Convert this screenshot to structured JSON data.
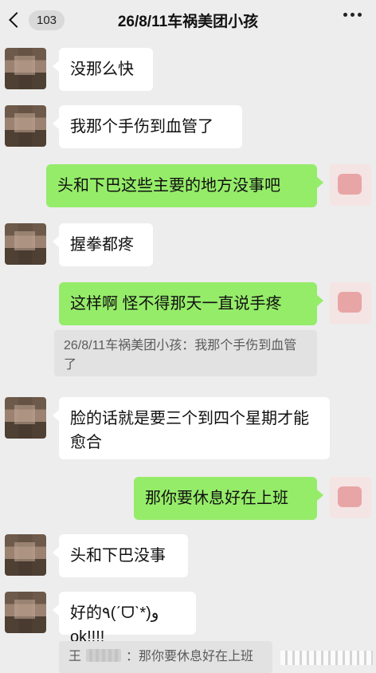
{
  "header": {
    "back_label": "<",
    "unread_count": "103",
    "title": "26/8/11车祸美团小孩",
    "more_icon": "more-dots-icon"
  },
  "messages": [
    {
      "side": "in",
      "text": "没那么快"
    },
    {
      "side": "in",
      "text": "我那个手伤到血管了"
    },
    {
      "side": "out",
      "text": "头和下巴这些主要的地方没事吧"
    },
    {
      "side": "in",
      "text": "握拳都疼"
    },
    {
      "side": "out",
      "text": "这样啊 怪不得那天一直说手疼"
    },
    {
      "side": "in",
      "text": "脸的话就是要三个到四个星期才能愈合"
    },
    {
      "side": "out",
      "text": "那你要休息好在上班"
    },
    {
      "side": "in",
      "text": "头和下巴没事"
    },
    {
      "side": "in",
      "text": "好的٩(ˊᗜˋ*)و ok!!!!"
    }
  ],
  "quotes": [
    {
      "text": "26/8/11车祸美团小孩：我那个手伤到血管了"
    },
    {
      "prefix": "王",
      "text": "：那你要休息好在上班"
    }
  ],
  "colors": {
    "background": "#ededed",
    "incoming_bubble": "#ffffff",
    "outgoing_bubble": "#95ec69",
    "quote_background": "#e2e2e2"
  }
}
